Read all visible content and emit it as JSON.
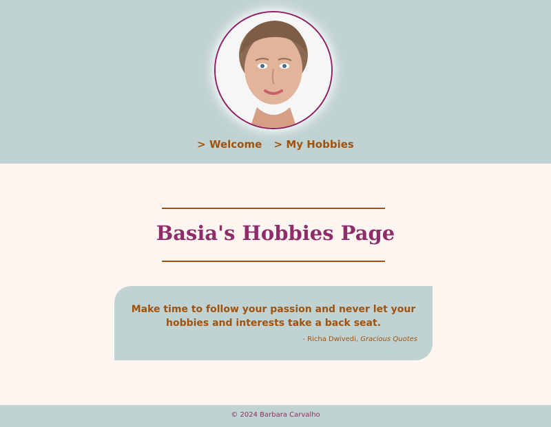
{
  "nav": {
    "items": [
      {
        "label": "> Welcome"
      },
      {
        "label": "> My Hobbies"
      }
    ]
  },
  "page": {
    "title": "Basia's Hobbies Page"
  },
  "quote": {
    "text": "Make time to follow your passion and never let your hobbies and interests take a back seat.",
    "author": "- Richa Dwivedi,",
    "source": "Gracious Quotes"
  },
  "footer": {
    "copyright": "© 2024 Barbara Carvalho"
  },
  "colors": {
    "header_bg": "#c0d3d2",
    "body_bg": "#fdf5f0",
    "accent_brown": "#a0520c",
    "accent_plum": "#8e2d6a"
  }
}
